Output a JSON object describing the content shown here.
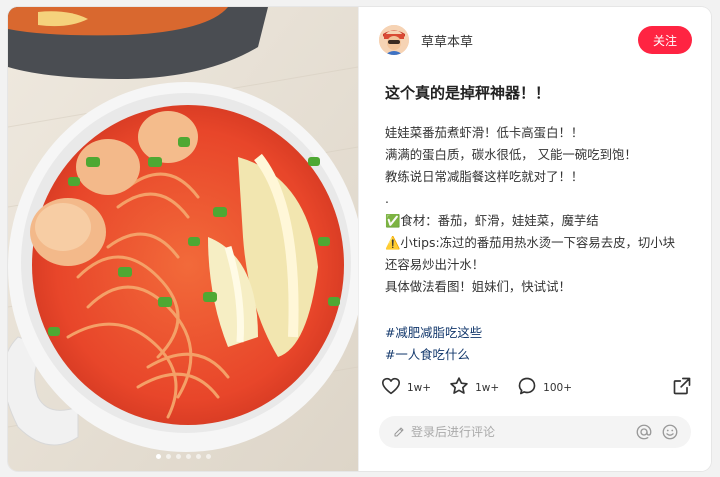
{
  "post": {
    "author": "草草本草",
    "follow_label": "关注",
    "title": "这个真的是掉秤神器！！",
    "lines": [
      "娃娃菜番茄煮虾滑！低卡高蛋白！！",
      "满满的蛋白质，碳水很低，  又能一碗吃到饱！",
      "教练说日常减脂餐这样吃就对了！！",
      ".",
      "✅食材：番茄，虾滑，娃娃菜，魔芋结",
      "⚠️小tips:冻过的番茄用热水烫一下容易去皮，切小块",
      "还容易炒出汁水！",
      "具体做法看图！姐妹们，快试试！"
    ],
    "tags": [
      "#减肥减脂吃这些",
      "#一人食吃什么"
    ]
  },
  "stats": {
    "likes": "1w+",
    "collects": "1w+",
    "comments": "100+"
  },
  "comment_box": {
    "placeholder": "登录后进行评论"
  },
  "gallery": {
    "total": 6,
    "current": 1
  },
  "colors": {
    "accent": "#ff2442",
    "tag": "#13386c"
  },
  "icons": {
    "like": "heart-icon",
    "collect": "star-icon",
    "comment": "comment-bubble-icon",
    "share": "share-icon",
    "edit": "pencil-icon",
    "mention": "at-icon",
    "emoji": "smiley-icon"
  }
}
